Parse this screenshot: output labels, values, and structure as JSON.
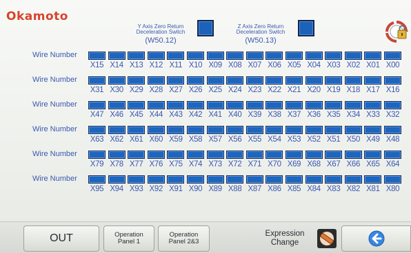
{
  "brand": {
    "logo_text": "Okamoto",
    "accent_color": "#d8442c"
  },
  "switches": [
    {
      "line1": "Y Axis Zero Return",
      "line2": "Deceleration Switch",
      "address": "(W50.12)",
      "lamp_color": "#1c62b8"
    },
    {
      "line1": "Z Axis Zero Return",
      "line2": "Deceleration Switch",
      "address": "(W50.13)",
      "lamp_color": "#1c62b8"
    }
  ],
  "header_icon": {
    "icon": "rotate-lock-icon"
  },
  "wire_rows": [
    {
      "label": "Wire Number",
      "bits": [
        "X15",
        "X14",
        "X13",
        "X12",
        "X11",
        "X10",
        "X09",
        "X08",
        "X07",
        "X06",
        "X05",
        "X04",
        "X03",
        "X02",
        "X01",
        "X00"
      ]
    },
    {
      "label": "Wire Number",
      "bits": [
        "X31",
        "X30",
        "X29",
        "X28",
        "X27",
        "X26",
        "X25",
        "X24",
        "X23",
        "X22",
        "X21",
        "X20",
        "X19",
        "X18",
        "X17",
        "X16"
      ]
    },
    {
      "label": "Wire Number",
      "bits": [
        "X47",
        "X46",
        "X45",
        "X44",
        "X43",
        "X42",
        "X41",
        "X40",
        "X39",
        "X38",
        "X37",
        "X36",
        "X35",
        "X34",
        "X33",
        "X32"
      ]
    },
    {
      "label": "Wire Number",
      "bits": [
        "X63",
        "X62",
        "X61",
        "X60",
        "X59",
        "X58",
        "X57",
        "X56",
        "X55",
        "X54",
        "X53",
        "X52",
        "X51",
        "X50",
        "X49",
        "X48"
      ]
    },
    {
      "label": "Wire Number",
      "bits": [
        "X79",
        "X78",
        "X77",
        "X76",
        "X75",
        "X74",
        "X73",
        "X72",
        "X71",
        "X70",
        "X69",
        "X68",
        "X67",
        "X66",
        "X65",
        "X64"
      ]
    },
    {
      "label": "Wire Number",
      "bits": [
        "X95",
        "X94",
        "X93",
        "X92",
        "X91",
        "X90",
        "X89",
        "X88",
        "X87",
        "X86",
        "X85",
        "X84",
        "X83",
        "X82",
        "X81",
        "X80"
      ]
    }
  ],
  "lamp_color": "#1d65bd",
  "footer": {
    "out_label": "OUT",
    "op1_line1": "Operation",
    "op1_line2": "Panel 1",
    "op23_line1": "Operation",
    "op23_line2": "Panel 2&3",
    "expr_line1": "Expression",
    "expr_line2": "Change",
    "expr_icon": "expression-change-icon",
    "back_icon": "back-arrow-icon"
  }
}
